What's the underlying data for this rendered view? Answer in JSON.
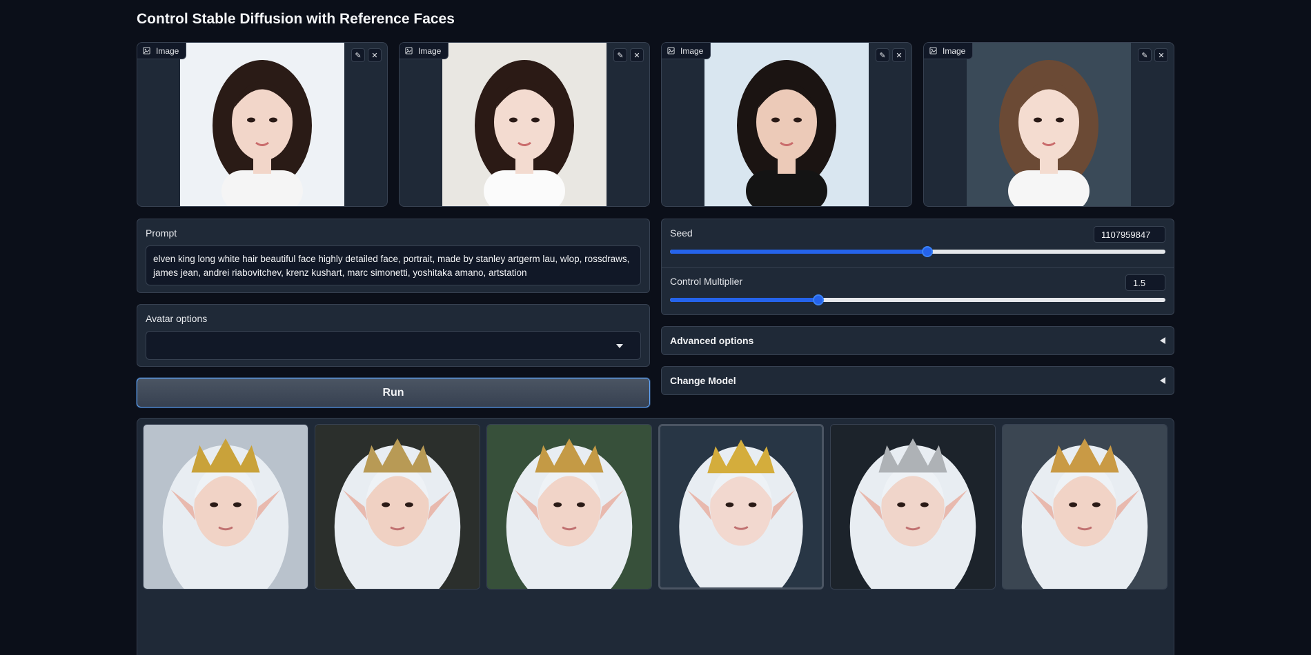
{
  "title": "Control Stable Diffusion with Reference Faces",
  "reference_images": [
    {
      "label": "Image",
      "icon": "image-icon",
      "bg": "#eef2f6",
      "hair": "#2a1b16",
      "skin": "#f2d6c9",
      "clothes": "#f5f5f5"
    },
    {
      "label": "Image",
      "icon": "image-icon",
      "bg": "#e9e7e2",
      "hair": "#2b1a15",
      "skin": "#f3dbd0",
      "clothes": "#fbfbfb"
    },
    {
      "label": "Image",
      "icon": "image-icon",
      "bg": "#d9e6f0",
      "hair": "#1b1412",
      "skin": "#eccab8",
      "clothes": "#141414"
    },
    {
      "label": "Image",
      "icon": "image-icon",
      "bg": "#3a4a58",
      "hair": "#6b4a35",
      "skin": "#f4dcd0",
      "clothes": "#f6f6f6"
    }
  ],
  "prompt": {
    "label": "Prompt",
    "value": "elven king long white hair beautiful face highly detailed face, portrait, made by stanley artgerm lau, wlop, rossdraws, james jean, andrei riabovitchev, krenz kushart, marc simonetti, yoshitaka amano, artstation"
  },
  "avatar_options": {
    "label": "Avatar options",
    "value": ""
  },
  "run_button": "Run",
  "seed": {
    "label": "Seed",
    "value": "1107959847",
    "fraction": 0.52
  },
  "control_multiplier": {
    "label": "Control Multiplier",
    "value": "1.5",
    "fraction": 0.3
  },
  "advanced_options": "Advanced options",
  "change_model": "Change Model",
  "gallery": [
    {
      "bg": "#b9c2cc",
      "crown": "#c9a23a",
      "skin": "#f1d3c6"
    },
    {
      "bg": "#2b2f2c",
      "crown": "#b89a55",
      "skin": "#f0d1c3"
    },
    {
      "bg": "#37503a",
      "crown": "#c49a45",
      "skin": "#f1d4c8"
    },
    {
      "bg": "#283645",
      "crown": "#d4ad3c",
      "skin": "#f2d8cf"
    },
    {
      "bg": "#1c232b",
      "crown": "#aeb2b6",
      "skin": "#f0d5ca"
    },
    {
      "bg": "#3b4652",
      "crown": "#c99a45",
      "skin": "#f1d3c6"
    }
  ],
  "selected_gallery_index": 3
}
